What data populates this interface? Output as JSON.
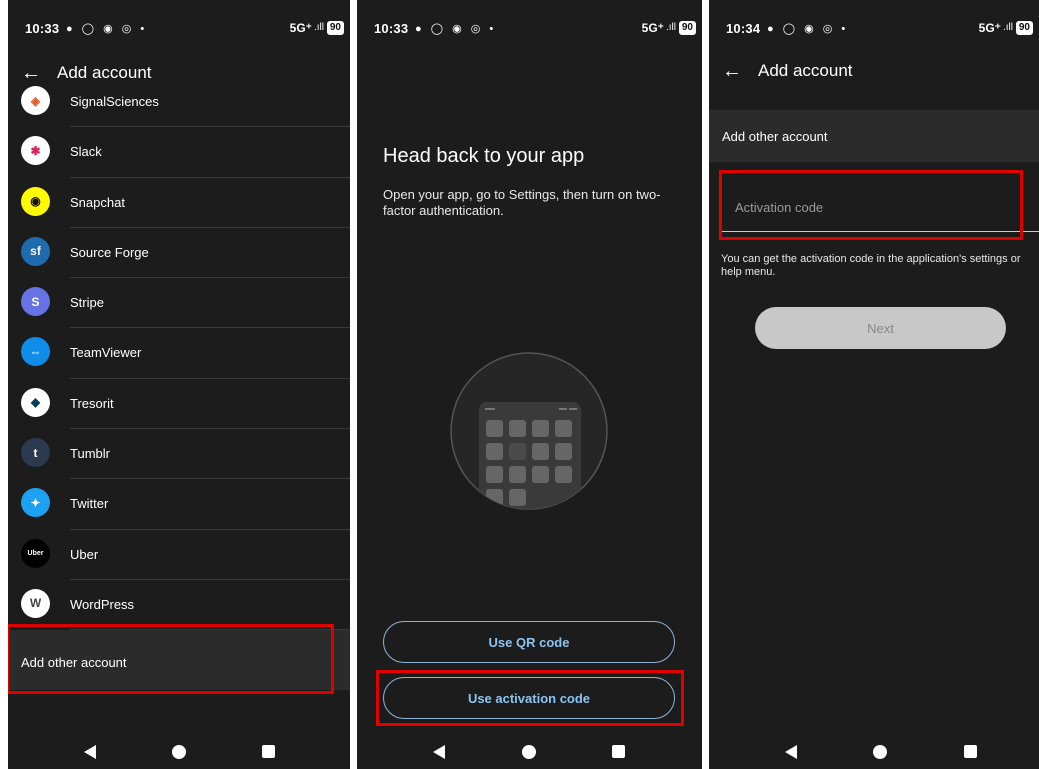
{
  "panel1": {
    "status": {
      "time": "10:33",
      "icons": "● ◯ ◉ ◎ •",
      "network": "5G⁺",
      "signal": ".ıll",
      "battery": "90"
    },
    "title": "Add account",
    "items": [
      {
        "label": "SignalSciences",
        "icon": "signalsciences-icon",
        "glyph": "◈",
        "color": "#e05a2a",
        "bg": "#ffffff"
      },
      {
        "label": "Slack",
        "icon": "slack-icon",
        "glyph": "✱",
        "color": "#e01e5a",
        "bg": "#ffffff"
      },
      {
        "label": "Snapchat",
        "icon": "snapchat-icon",
        "glyph": "◉",
        "color": "#111111",
        "bg": "#fffc00"
      },
      {
        "label": "Source Forge",
        "icon": "sourceforge-icon",
        "glyph": "sf",
        "color": "#ffffff",
        "bg": "#1f6bb0"
      },
      {
        "label": "Stripe",
        "icon": "stripe-icon",
        "glyph": "S",
        "color": "#ffffff",
        "bg": "#6772e5"
      },
      {
        "label": "TeamViewer",
        "icon": "teamviewer-icon",
        "glyph": "⇔",
        "color": "#ffffff",
        "bg": "#0e8ee9"
      },
      {
        "label": "Tresorit",
        "icon": "tresorit-icon",
        "glyph": "◆",
        "color": "#0b3c5d",
        "bg": "#ffffff"
      },
      {
        "label": "Tumblr",
        "icon": "tumblr-icon",
        "glyph": "t",
        "color": "#ffffff",
        "bg": "#2b3a4e"
      },
      {
        "label": "Twitter",
        "icon": "twitter-icon",
        "glyph": "✦",
        "color": "#ffffff",
        "bg": "#1da1f2"
      },
      {
        "label": "Uber",
        "icon": "uber-icon",
        "glyph": "Uber",
        "color": "#ffffff",
        "bg": "#000000"
      },
      {
        "label": "WordPress",
        "icon": "wordpress-icon",
        "glyph": "W",
        "color": "#464646",
        "bg": "#ffffff"
      }
    ],
    "other_account": "Add other account"
  },
  "panel2": {
    "status": {
      "time": "10:33",
      "icons": "● ◯ ◉ ◎ •",
      "network": "5G⁺",
      "signal": ".ıll",
      "battery": "90"
    },
    "heading": "Head back to your app",
    "body": "Open your app, go to Settings, then turn on two-factor authentication.",
    "qr_button": "Use QR code",
    "activation_button": "Use activation code"
  },
  "panel3": {
    "status": {
      "time": "10:34",
      "icons": "● ◯ ◉ ◎ •",
      "network": "5G⁺",
      "signal": ".ıll",
      "battery": "90"
    },
    "title": "Add account",
    "section_label": "Add other account",
    "field_placeholder": "Activation code",
    "help_text_line1": "You can get the activation code in the application's settings or",
    "help_text_line2": "help menu.",
    "next_button": "Next"
  },
  "colors": {
    "background": "#1c1c1c",
    "accent_outline": "#8cb4dc",
    "highlight": "#e00000"
  }
}
